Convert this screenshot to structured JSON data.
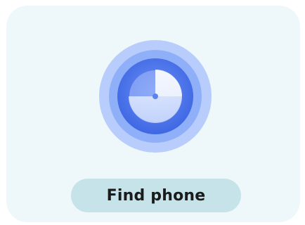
{
  "widget": {
    "icon": "radar-locate-icon",
    "button_label": "Find phone"
  },
  "colors": {
    "card_background": "#eef7fa",
    "button_background": "#c6e3ea",
    "radar_outer": "#b8cdfb",
    "radar_mid": "#8fb0f8",
    "radar_inner": "#4e78ee",
    "radar_core": "#3f6ae6",
    "sweep": "#ffffff"
  }
}
